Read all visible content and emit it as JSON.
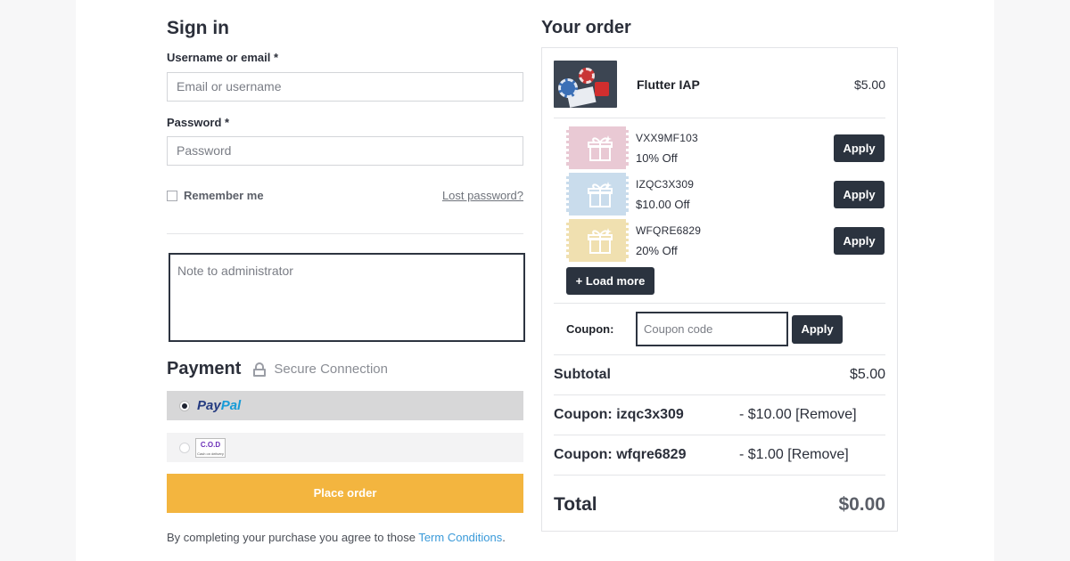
{
  "signin": {
    "title": "Sign in",
    "username_label": "Username or email *",
    "username_placeholder": "Email or username",
    "password_label": "Password *",
    "password_placeholder": "Password",
    "remember_label": "Remember me",
    "lost_password": "Lost password?"
  },
  "note": {
    "placeholder": "Note to administrator"
  },
  "payment": {
    "title": "Payment",
    "secure_label": "Secure Connection",
    "paypal_part1": "Pay",
    "paypal_part2": "Pal",
    "cod_line1": "C.O.D",
    "cod_line2": "Cash on delivery",
    "place_order": "Place order",
    "terms_text": "By completing your purchase you agree to those ",
    "terms_link": "Term Conditions",
    "terms_end": "."
  },
  "order": {
    "title": "Your order",
    "product": {
      "name": "Flutter IAP",
      "price": "$5.00"
    },
    "coupons": [
      {
        "code": "VXX9MF103",
        "discount": "10% Off",
        "color": "#e9c9d4",
        "apply": "Apply"
      },
      {
        "code": "IZQC3X309",
        "discount": "$10.00 Off",
        "color": "#c9dcec",
        "apply": "Apply"
      },
      {
        "code": "WFQRE6829",
        "discount": "20% Off",
        "color": "#f0e0b0",
        "apply": "Apply"
      }
    ],
    "load_more": "+ Load more",
    "coupon_label": "Coupon:",
    "coupon_placeholder": "Coupon code",
    "coupon_apply": "Apply",
    "subtotal_label": "Subtotal",
    "subtotal_value": "$5.00",
    "applied": [
      {
        "label": "Coupon: izqc3x309",
        "value": "- $10.00 [Remove]"
      },
      {
        "label": "Coupon: wfqre6829",
        "value": "- $1.00 [Remove]"
      }
    ],
    "total_label": "Total",
    "total_value": "$0.00"
  },
  "colors": {
    "place_order": "#f3b53f",
    "dark_button": "#2b333f",
    "link": "#3a9ad9"
  }
}
